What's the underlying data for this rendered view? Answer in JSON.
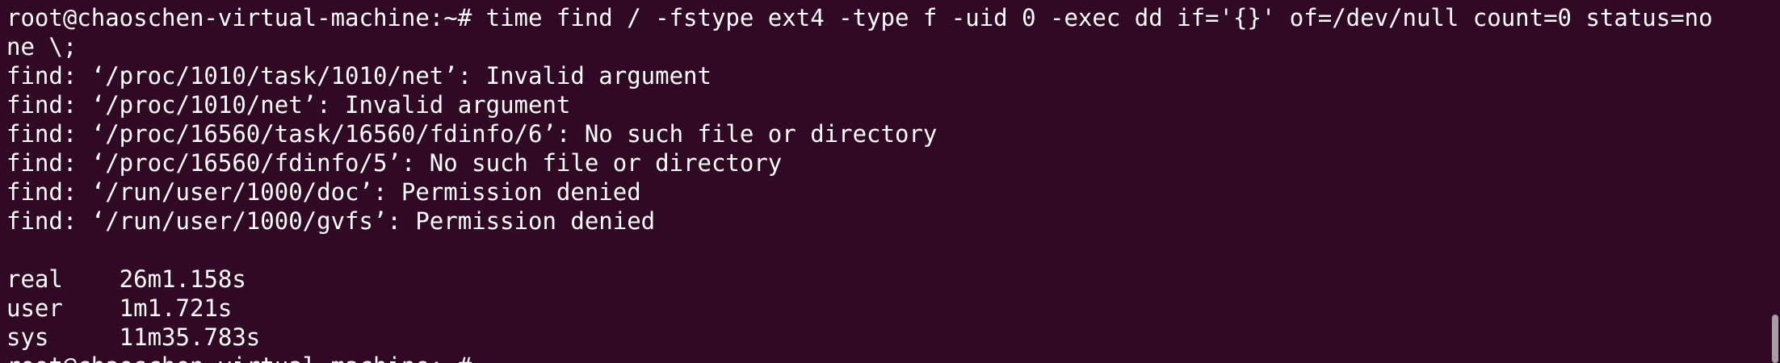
{
  "terminal": {
    "lines": [
      "root@chaoschen-virtual-machine:~# time find / -fstype ext4 -type f -uid 0 -exec dd if='{}' of=/dev/null count=0 status=no",
      "ne \\;",
      "find: ‘/proc/1010/task/1010/net’: Invalid argument",
      "find: ‘/proc/1010/net’: Invalid argument",
      "find: ‘/proc/16560/task/16560/fdinfo/6’: No such file or directory",
      "find: ‘/proc/16560/fdinfo/5’: No such file or directory",
      "find: ‘/run/user/1000/doc’: Permission denied",
      "find: ‘/run/user/1000/gvfs’: Permission denied",
      "",
      "real\t26m1.158s",
      "user\t1m1.721s",
      "sys\t11m35.783s",
      "root@chaoschen-virtual-machine:~# "
    ]
  },
  "colors": {
    "background": "#300a24",
    "foreground": "#ffffff"
  }
}
